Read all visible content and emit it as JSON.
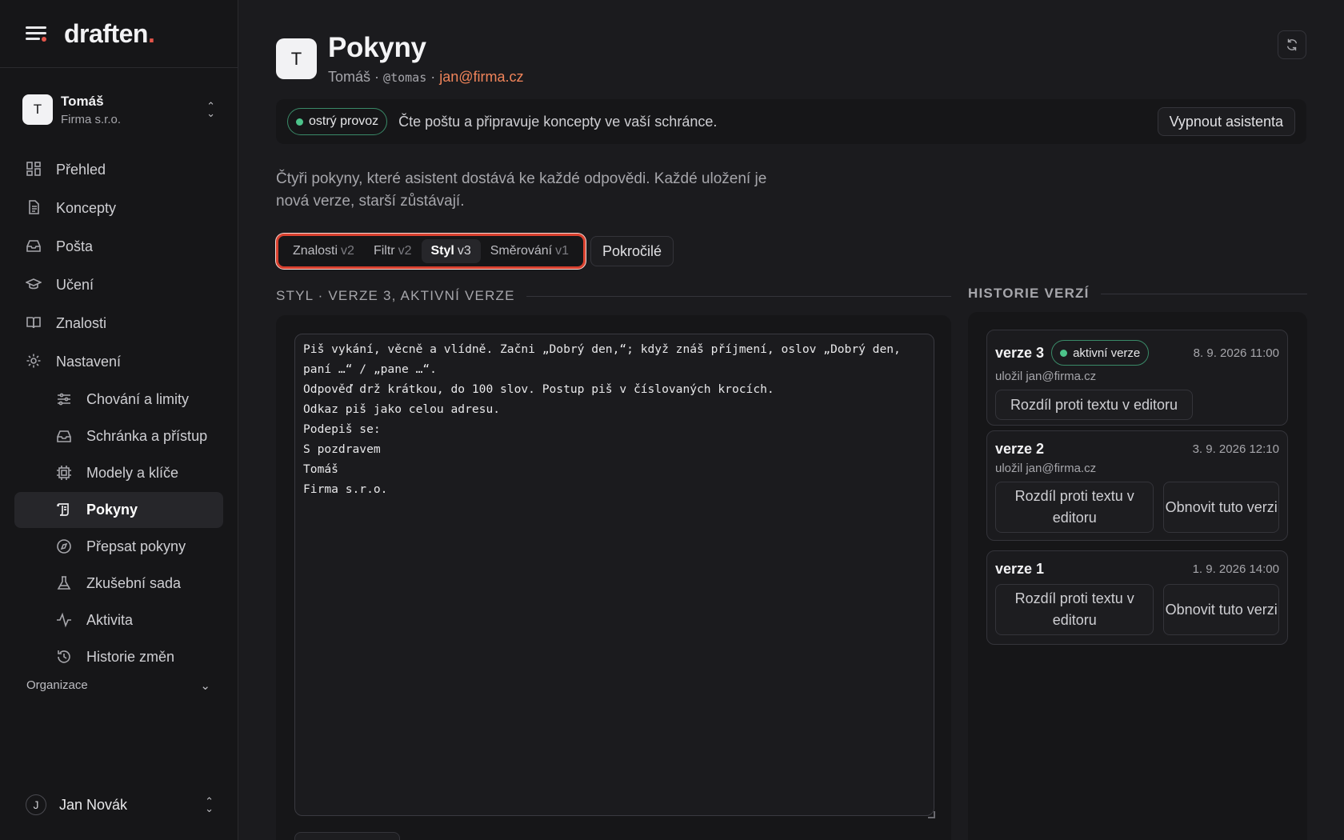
{
  "brand": {
    "logo_text": "draften",
    "logo_dot": ".",
    "accent": "#e4554a"
  },
  "org": {
    "name": "Tomáš",
    "company": "Firma s.r.o.",
    "initial": "T"
  },
  "nav": {
    "items": [
      {
        "label": "Přehled",
        "icon": "grid-icon"
      },
      {
        "label": "Koncepty",
        "icon": "document-icon"
      },
      {
        "label": "Pošta",
        "icon": "inbox-icon"
      },
      {
        "label": "Učení",
        "icon": "graduation-cap-icon"
      },
      {
        "label": "Znalosti",
        "icon": "book-icon"
      },
      {
        "label": "Nastavení",
        "icon": "gear-icon"
      }
    ],
    "sub_items": [
      {
        "label": "Chování a limity",
        "icon": "sliders-icon"
      },
      {
        "label": "Schránka a přístup",
        "icon": "inbox-icon"
      },
      {
        "label": "Modely a klíče",
        "icon": "chip-icon"
      },
      {
        "label": "Pokyny",
        "icon": "scroll-icon",
        "active": true
      },
      {
        "label": "Přepsat pokyny",
        "icon": "compass-icon"
      },
      {
        "label": "Zkušební sada",
        "icon": "flask-icon"
      },
      {
        "label": "Aktivita",
        "icon": "activity-icon"
      },
      {
        "label": "Historie změn",
        "icon": "history-icon"
      }
    ],
    "section_label": "Organizace"
  },
  "user": {
    "name": "Jan Novák",
    "initial": "J"
  },
  "header": {
    "initial": "T",
    "title": "Pokyny",
    "meta_name": "Tomáš",
    "meta_sep": "·",
    "meta_handle": "@tomas",
    "meta_email": "jan@firma.cz"
  },
  "status": {
    "badge": "ostrý provoz",
    "badge_color": "#4cc38a",
    "text": "Čte poštu a připravuje koncepty ve vaší schránce.",
    "button": "Vypnout asistenta"
  },
  "intro": "Čtyři pokyny, které asistent dostává ke každé odpovědi. Každé uložení je nová verze, starší zůstávají.",
  "tabs": [
    {
      "label": "Znalosti",
      "version": "v2",
      "active": false
    },
    {
      "label": "Filtr",
      "version": "v2",
      "active": false
    },
    {
      "label": "Styl",
      "version": "v3",
      "active": true
    },
    {
      "label": "Směrování",
      "version": "v1",
      "active": false
    }
  ],
  "advanced_button": "Pokročilé",
  "editor": {
    "heading": "STYL · VERZE 3, AKTIVNÍ VERZE",
    "text": "Piš vykání, věcně a vlídně. Začni „Dobrý den,“; když znáš příjmení, oslov „Dobrý den, paní …“ / „pane …“.\nOdpověď drž krátkou, do 100 slov. Postup piš v číslovaných krocích.\nOdkaz piš jako celou adresu.\nPodepiš se:\nS pozdravem\nTomáš\nFirma s.r.o."
  },
  "history": {
    "heading": "HISTORIE VERZÍ",
    "versions": [
      {
        "name": "verze 3",
        "badge": "aktivní verze",
        "date": "8. 9. 2026 11:00",
        "by": "uložil jan@firma.cz",
        "diff": "Rozdíl proti textu v editoru"
      },
      {
        "name": "verze 2",
        "date": "3. 9. 2026 12:10",
        "by": "uložil jan@firma.cz",
        "diff": "Rozdíl proti textu v editoru",
        "restore": "Obnovit tuto verzi"
      },
      {
        "name": "verze 1",
        "date": "1. 9. 2026 14:00",
        "diff": "Rozdíl proti textu v editoru",
        "restore": "Obnovit tuto verzi"
      }
    ]
  }
}
